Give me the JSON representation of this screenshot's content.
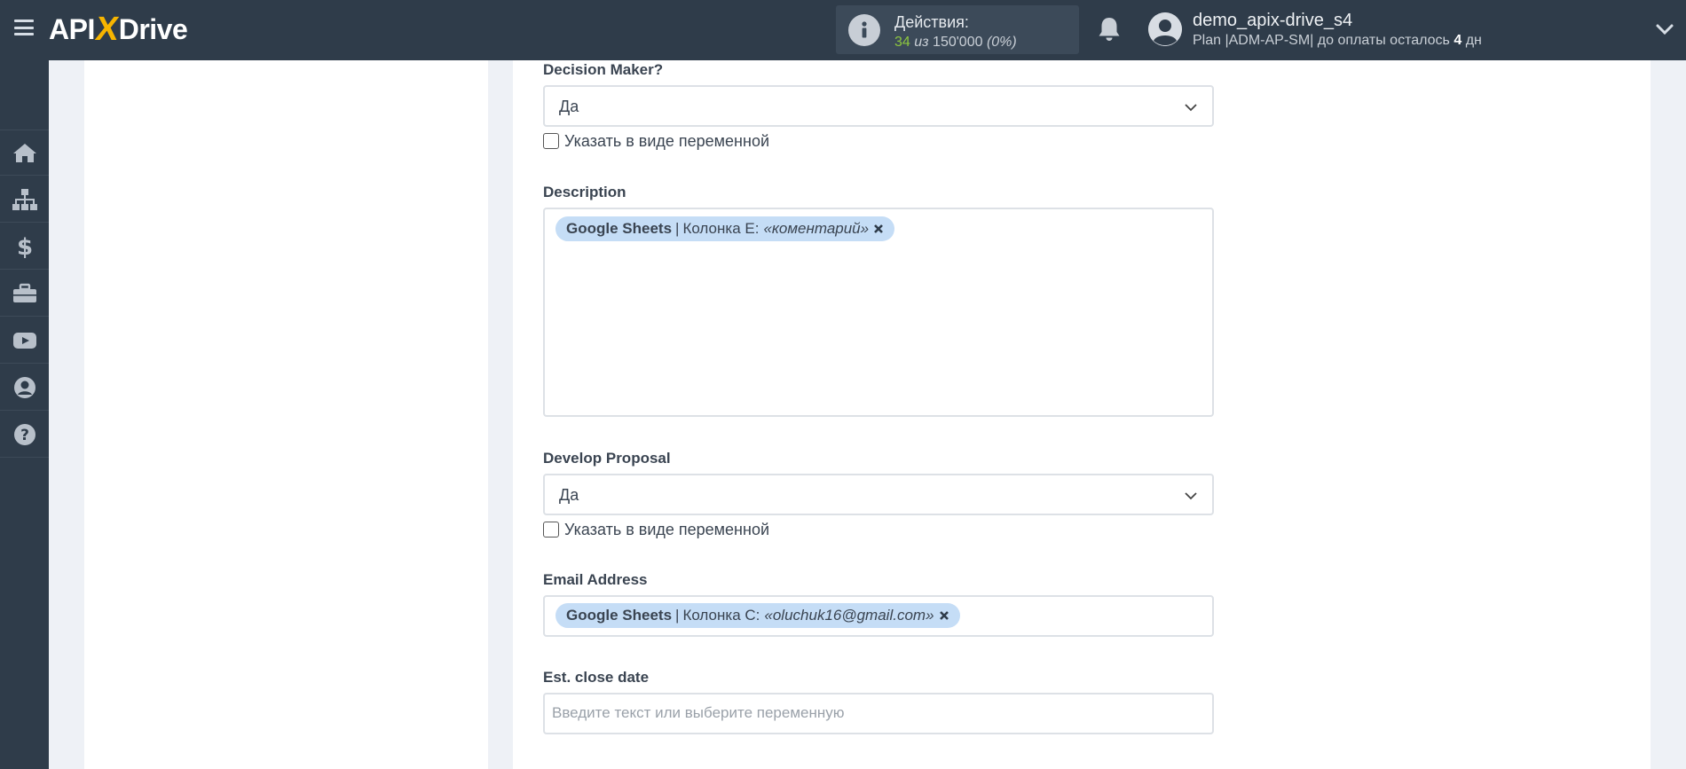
{
  "header": {
    "logo_left": "API",
    "logo_x": "X",
    "logo_right": "Drive",
    "actions": {
      "title": "Действия:",
      "used": "34",
      "of": "из",
      "total": "150'000",
      "percent": "(0%)"
    },
    "user": {
      "name": "demo_apix-drive_s4",
      "plan_prefix": "Plan |ADM-AP-SM| до оплаты осталось",
      "days": "4",
      "days_unit": "дн"
    }
  },
  "sidebar": {
    "items": [
      {
        "icon": "home-icon"
      },
      {
        "icon": "sitemap-icon"
      },
      {
        "icon": "dollar-icon"
      },
      {
        "icon": "briefcase-icon"
      },
      {
        "icon": "youtube-icon"
      },
      {
        "icon": "user-circle-icon"
      },
      {
        "icon": "question-circle-icon"
      }
    ]
  },
  "form": {
    "decision_maker": {
      "label": "Decision Maker?",
      "value": "Да",
      "variable_checkbox_label": "Указать в виде переменной"
    },
    "description": {
      "label": "Description",
      "tag": {
        "source": "Google Sheets",
        "separator": "|",
        "column": "Колонка E:",
        "sample": "«коментарий»"
      }
    },
    "develop_proposal": {
      "label": "Develop Proposal",
      "value": "Да",
      "variable_checkbox_label": "Указать в виде переменной"
    },
    "email_address": {
      "label": "Email Address",
      "tag": {
        "source": "Google Sheets",
        "separator": "|",
        "column": "Колонка C:",
        "sample": "«oluchuk16@gmail.com»"
      }
    },
    "est_close_date": {
      "label": "Est. close date",
      "placeholder": "Введите текст или выберите переменную"
    }
  },
  "colors": {
    "topbar": "#2f3c4a",
    "accent_green": "#8dc63f",
    "logo_x": "#f7b500",
    "tag_bg": "#c5ddf6"
  }
}
